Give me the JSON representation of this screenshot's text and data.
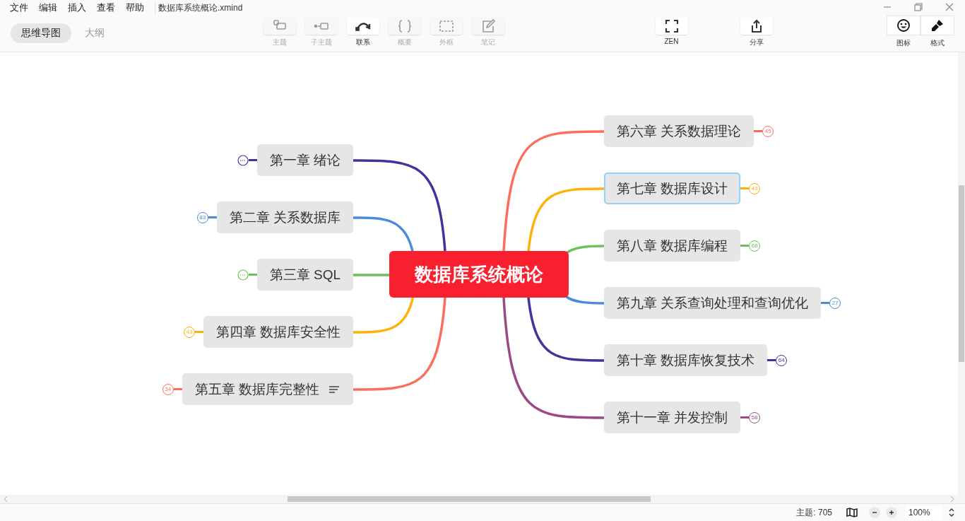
{
  "menu": [
    "文件",
    "编辑",
    "插入",
    "查看",
    "帮助"
  ],
  "file_name": "数据库系统概论.xmind",
  "view_tabs": [
    {
      "label": "思维导图",
      "selected": true
    },
    {
      "label": "大纲",
      "selected": false
    }
  ],
  "tools": [
    {
      "kind": "topic",
      "label": "主题",
      "disabled": true
    },
    {
      "kind": "subtopic",
      "label": "子主题",
      "disabled": true
    },
    {
      "kind": "relation",
      "label": "联系",
      "disabled": false
    },
    {
      "kind": "summary",
      "label": "概要",
      "disabled": true
    },
    {
      "kind": "boundary",
      "label": "外框",
      "disabled": true
    },
    {
      "kind": "note",
      "label": "笔记",
      "disabled": true
    }
  ],
  "zen": {
    "label": "ZEN"
  },
  "share": {
    "label": "分享"
  },
  "panel_tabs": [
    {
      "kind": "icon",
      "label": "图标"
    },
    {
      "kind": "format",
      "label": "格式"
    }
  ],
  "map": {
    "central_topic": "数据库系统概论",
    "left": [
      {
        "title": "第一章 绪论",
        "color": "#43349a",
        "collapsed": true,
        "selected": false
      },
      {
        "title": "第二章 关系数据库",
        "color": "#4a8ad8",
        "count": "83",
        "selected": false
      },
      {
        "title": "第三章 SQL",
        "color": "#6cc15a",
        "collapsed": true,
        "selected": false
      },
      {
        "title": "第四章 数据库安全性",
        "color": "#fbb20a",
        "count": "43",
        "selected": false
      },
      {
        "title": "第五章 数据库完整性",
        "color": "#fb6e5e",
        "count": "34",
        "has_note": true,
        "selected": false
      }
    ],
    "right": [
      {
        "title": "第六章 关系数据理论",
        "color": "#fb6e5e",
        "count": "45",
        "selected": false
      },
      {
        "title": "第七章 数据库设计",
        "color": "#fbb20a",
        "count": "43",
        "selected": true
      },
      {
        "title": "第八章 数据库编程",
        "color": "#6cc15a",
        "count": "68",
        "selected": false
      },
      {
        "title": "第九章 关系查询处理和查询优化",
        "color": "#4a8ad8",
        "count": "27",
        "selected": false
      },
      {
        "title": "第十章 数据库恢复技术",
        "color": "#43349a",
        "count": "64",
        "selected": false
      },
      {
        "title": "第十一章 并发控制",
        "color": "#9c4a86",
        "count": "58",
        "selected": false
      }
    ]
  },
  "status_bar": {
    "topic_count": "主题: 705",
    "zoom": "100%"
  }
}
